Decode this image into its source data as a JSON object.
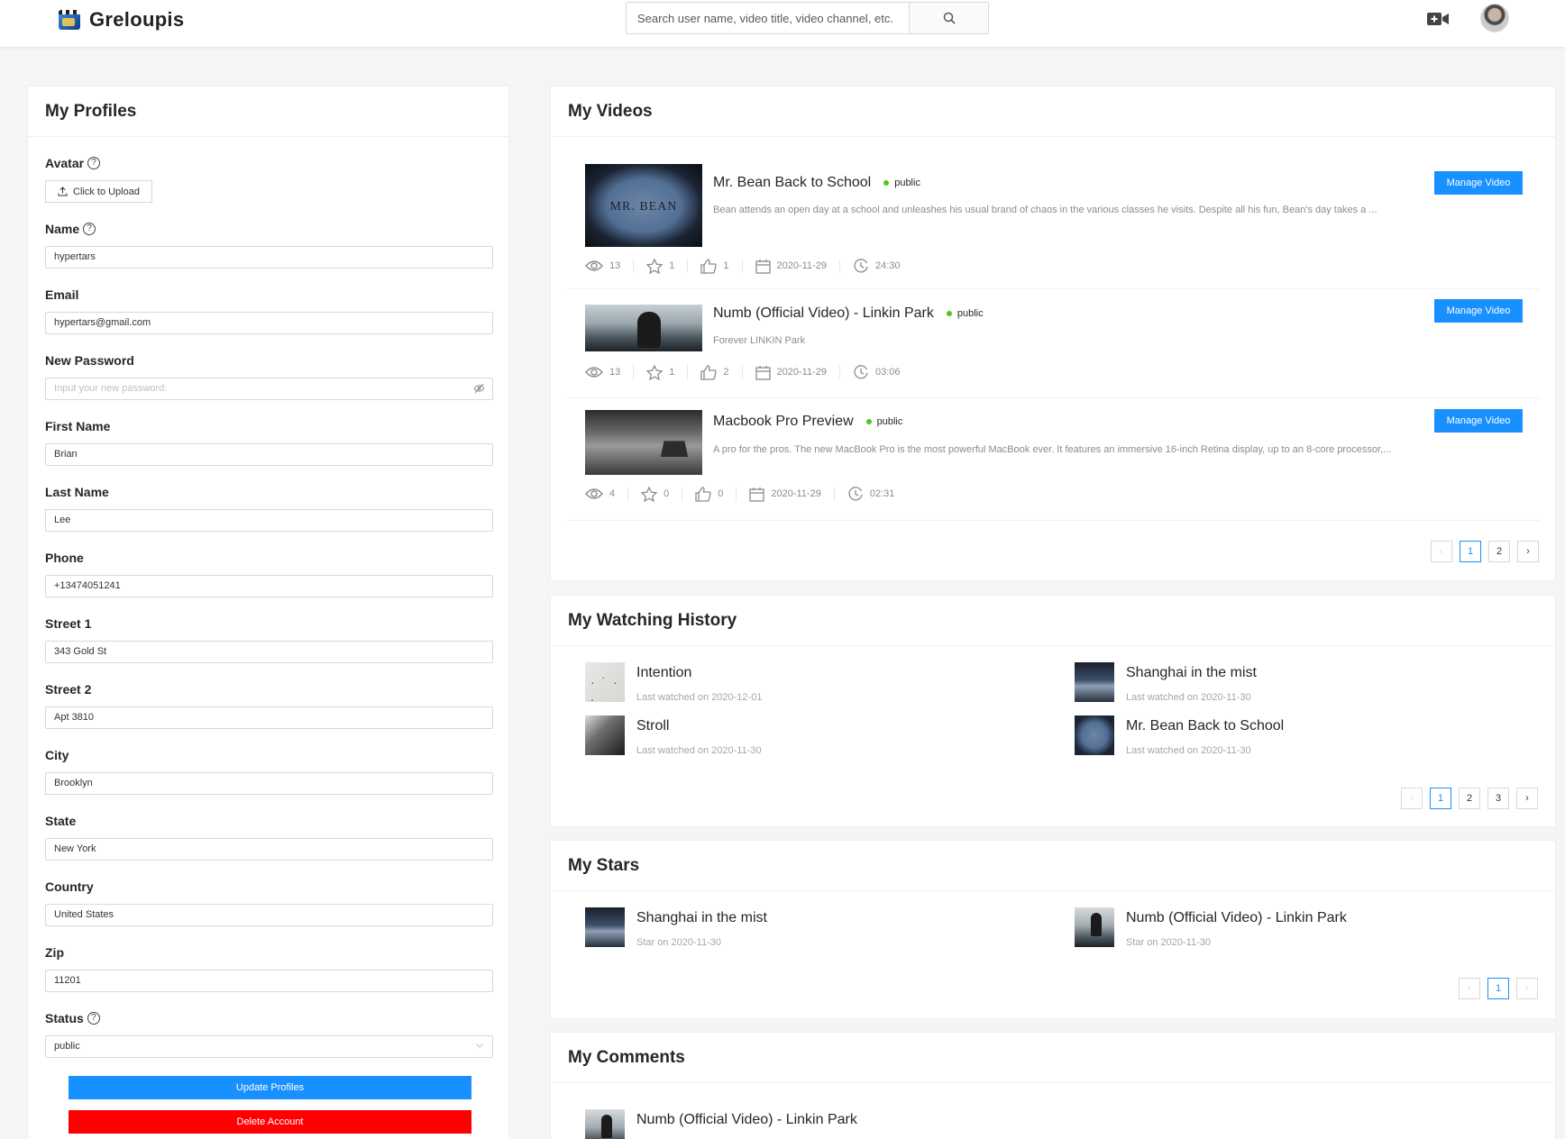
{
  "app": {
    "name": "Greloupis",
    "search_placeholder": "Search user name, video title, video channel, etc."
  },
  "profile": {
    "title": "My Profiles",
    "avatar_label": "Avatar",
    "upload_label": "Click to Upload",
    "fields": [
      {
        "label": "Name",
        "value": "hypertars",
        "help": true
      },
      {
        "label": "Email",
        "value": "hypertars@gmail.com"
      },
      {
        "label": "New Password",
        "placeholder": "Input your new password:"
      },
      {
        "label": "First Name",
        "value": "Brian"
      },
      {
        "label": "Last Name",
        "value": "Lee"
      },
      {
        "label": "Phone",
        "value": "+13474051241"
      },
      {
        "label": "Street 1",
        "value": "343 Gold St"
      },
      {
        "label": "Street 2",
        "value": "Apt 3810"
      },
      {
        "label": "City",
        "value": "Brooklyn"
      },
      {
        "label": "State",
        "value": "New York"
      },
      {
        "label": "Country",
        "value": "United States"
      },
      {
        "label": "Zip",
        "value": "11201"
      },
      {
        "label": "Status",
        "value": "public",
        "help": true
      }
    ],
    "update_label": "Update Profiles",
    "delete_label": "Delete Account"
  },
  "videos": {
    "title": "My Videos",
    "manage_label": "Manage Video",
    "items": [
      {
        "title": "Mr. Bean Back to School",
        "status": "public",
        "description": "Bean attends an open day at a school and unleashes his usual brand of chaos in the various classes he visits. Despite all his fun, Bean's day takes a ...",
        "views": "13",
        "stars": "1",
        "likes": "1",
        "date": "2020-11-29",
        "duration": "24:30"
      },
      {
        "title": "Numb (Official Video) - Linkin Park",
        "status": "public",
        "description": "Forever LINKIN Park",
        "views": "13",
        "stars": "1",
        "likes": "2",
        "date": "2020-11-29",
        "duration": "03:06"
      },
      {
        "title": "Macbook Pro Preview",
        "status": "public",
        "description": "A pro for the pros. The new MacBook Pro is the most powerful MacBook ever. It features an immersive 16-inch Retina display, up to an 8-core processor,...",
        "views": "4",
        "stars": "0",
        "likes": "0",
        "date": "2020-11-29",
        "duration": "02:31"
      }
    ],
    "pages": [
      "1",
      "2"
    ]
  },
  "history": {
    "title": "My Watching History",
    "items": [
      {
        "title": "Intention",
        "sub": "Last watched on 2020-12-01"
      },
      {
        "title": "Shanghai in the mist",
        "sub": "Last watched on 2020-11-30"
      },
      {
        "title": "Stroll",
        "sub": "Last watched on 2020-11-30"
      },
      {
        "title": "Mr. Bean Back to School",
        "sub": "Last watched on 2020-11-30"
      }
    ],
    "pages": [
      "1",
      "2",
      "3"
    ]
  },
  "stars": {
    "title": "My Stars",
    "items": [
      {
        "title": "Shanghai in the mist",
        "sub": "Star on 2020-11-30"
      },
      {
        "title": "Numb (Official Video) - Linkin Park",
        "sub": "Star on 2020-11-30"
      }
    ],
    "pages": [
      "1"
    ]
  },
  "comments": {
    "title": "My Comments",
    "items": [
      {
        "title": "Numb (Official Video) - Linkin Park"
      }
    ]
  },
  "colors": {
    "primary": "#1890ff",
    "danger": "#ff0000",
    "status_dot": "#52c41a"
  }
}
